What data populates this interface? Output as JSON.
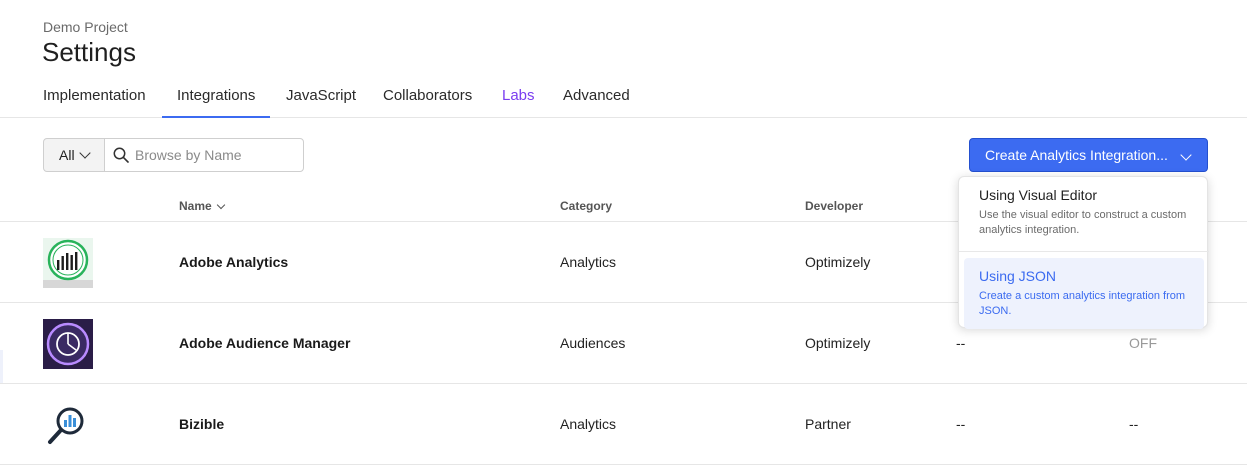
{
  "header": {
    "project": "Demo Project",
    "title": "Settings"
  },
  "tabs": [
    {
      "label": "Implementation"
    },
    {
      "label": "Integrations"
    },
    {
      "label": "JavaScript"
    },
    {
      "label": "Collaborators"
    },
    {
      "label": "Labs"
    },
    {
      "label": "Advanced"
    }
  ],
  "active_tab": "Integrations",
  "filter": {
    "selected": "All"
  },
  "search": {
    "placeholder": "Browse by Name",
    "value": ""
  },
  "create_button": {
    "label": "Create Analytics Integration..."
  },
  "table": {
    "columns": [
      "Name",
      "Category",
      "Developer"
    ],
    "rows": [
      {
        "name": "Adobe Analytics",
        "category": "Analytics",
        "developer": "Optimizely",
        "col4": "-",
        "col5": "",
        "logo": "adobe-analytics-logo"
      },
      {
        "name": "Adobe Audience Manager",
        "category": "Audiences",
        "developer": "Optimizely",
        "col4": "--",
        "col5": "OFF",
        "logo": "adobe-audience-manager-logo"
      },
      {
        "name": "Bizible",
        "category": "Analytics",
        "developer": "Partner",
        "col4": "--",
        "col5": "--",
        "logo": "bizible-logo"
      }
    ]
  },
  "dropdown_menu": {
    "items": [
      {
        "title": "Using Visual Editor",
        "description": "Use the visual editor to construct a custom analytics integration."
      },
      {
        "title": "Using JSON",
        "description": "Create a custom analytics integration from JSON."
      }
    ]
  },
  "colors": {
    "accent": "#3c6bf1",
    "labs": "#7a3df0"
  }
}
